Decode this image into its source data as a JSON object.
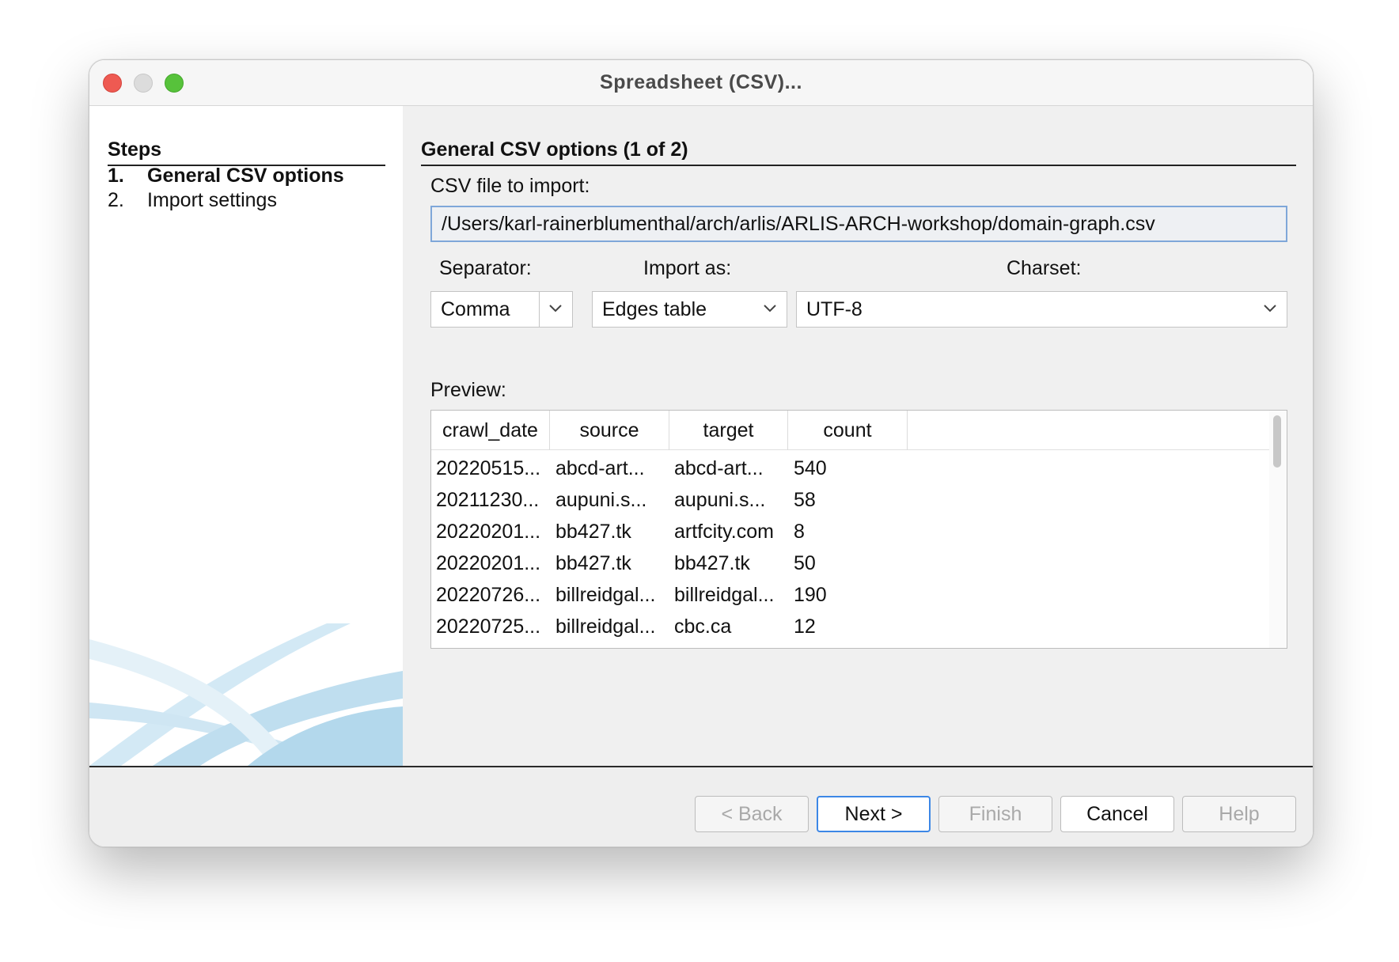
{
  "window": {
    "title": "Spreadsheet (CSV)..."
  },
  "steps": {
    "heading": "Steps",
    "items": [
      {
        "num": "1.",
        "label": "General CSV options"
      },
      {
        "num": "2.",
        "label": "Import settings"
      }
    ]
  },
  "main": {
    "section_title": "General CSV options (1 of 2)",
    "file_label": "CSV file to import:",
    "file_path": "/Users/karl-rainerblumenthal/arch/arlis/ARLIS-ARCH-workshop/domain-graph.csv",
    "separator_label": "Separator:",
    "separator_value": "Comma",
    "import_as_label": "Import as:",
    "import_as_value": "Edges table",
    "charset_label": "Charset:",
    "charset_value": "UTF-8",
    "preview_label": "Preview:",
    "preview": {
      "columns": [
        "crawl_date",
        "source",
        "target",
        "count"
      ],
      "rows": [
        [
          "20220515...",
          "abcd-art...",
          "abcd-art...",
          "540"
        ],
        [
          "20211230...",
          "aupuni.s...",
          "aupuni.s...",
          "58"
        ],
        [
          "20220201...",
          "bb427.tk",
          "artfcity.com",
          "8"
        ],
        [
          "20220201...",
          "bb427.tk",
          "bb427.tk",
          "50"
        ],
        [
          "20220726...",
          "billreidgal...",
          "billreidgal...",
          "190"
        ],
        [
          "20220725...",
          "billreidgal...",
          "cbc.ca",
          "12"
        ]
      ]
    }
  },
  "footer": {
    "back": "< Back",
    "next": "Next >",
    "finish": "Finish",
    "cancel": "Cancel",
    "help": "Help"
  }
}
